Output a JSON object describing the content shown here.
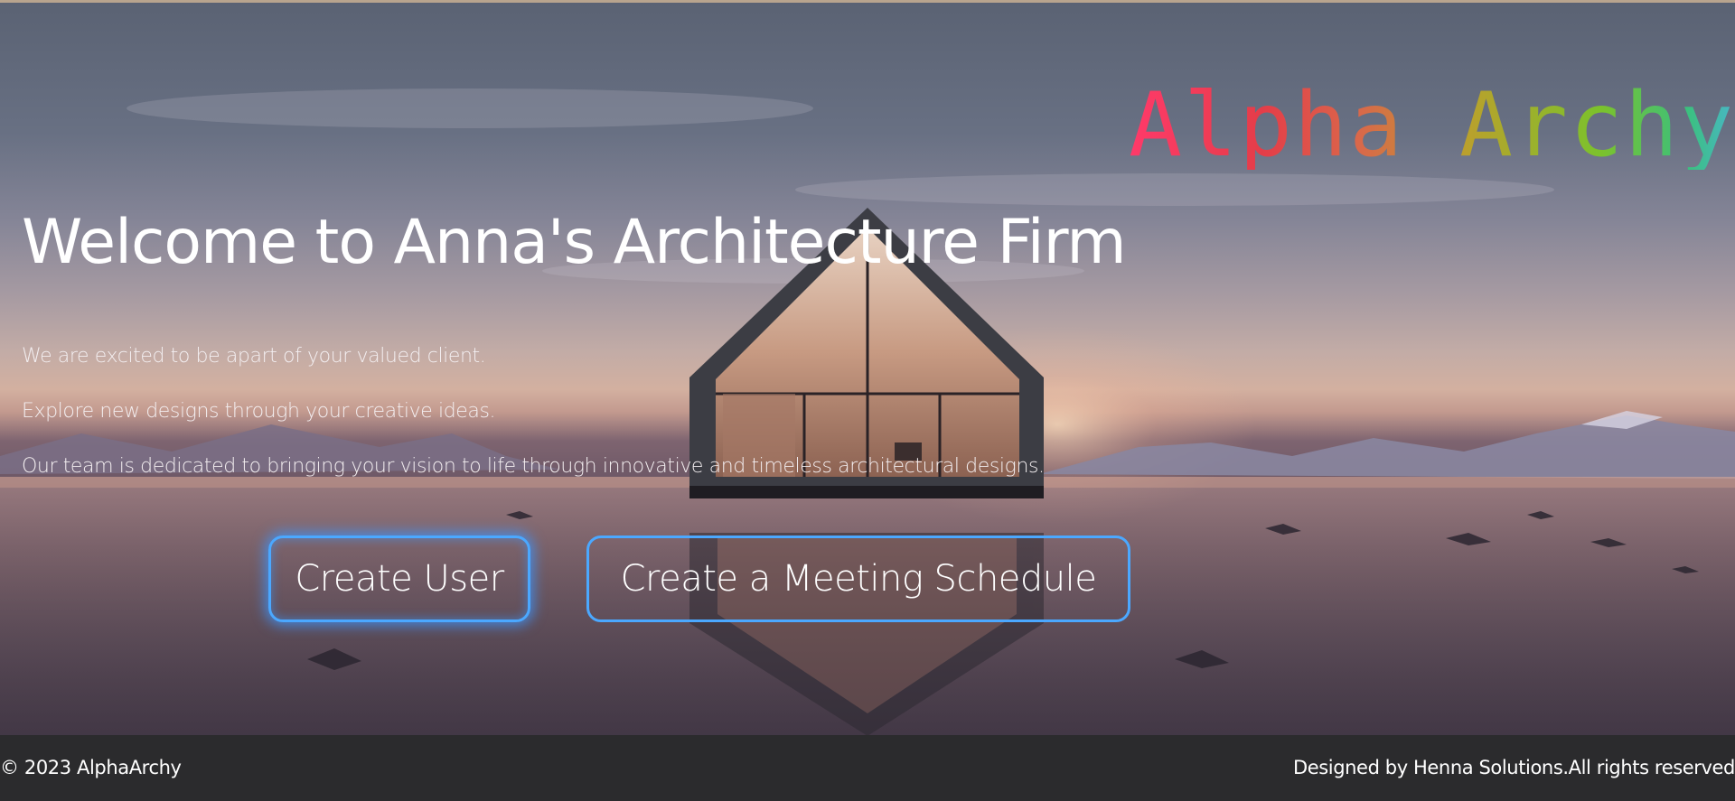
{
  "brand": {
    "name": "Alpha Archy"
  },
  "hero": {
    "headline": "Welcome to Anna's Architecture Firm",
    "paragraphs": [
      "We are excited to be apart of your valued client.",
      "Explore new designs through your creative ideas.",
      "Our team is dedicated to bringing your vision to life through innovative and timeless architectural designs."
    ],
    "background": "hero-background-photo"
  },
  "buttons": {
    "create_user": "Create User",
    "create_meeting": "Create a Meeting Schedule"
  },
  "footer": {
    "copyright": "© 2023 AlphaArchy",
    "credit": "Designed by Henna Solutions.All rights reserved"
  },
  "colors": {
    "button_border": "#4ba8ff",
    "footer_bg": "#2b2b2d",
    "brand_gradient": [
      "#ff3a6a",
      "#e43d49",
      "#d9684a",
      "#b9a12c",
      "#7bc22c",
      "#3bc07d",
      "#49b6c7"
    ]
  }
}
